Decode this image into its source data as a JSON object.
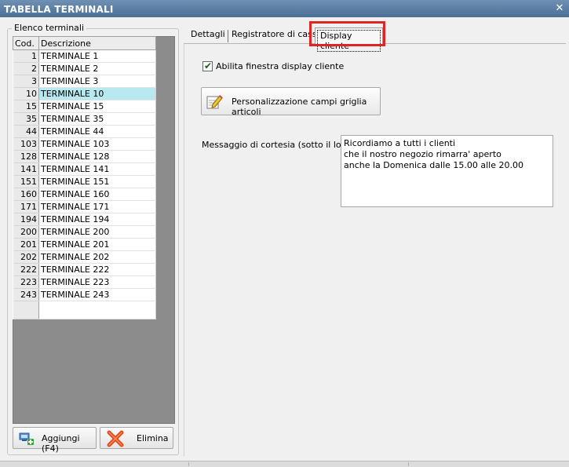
{
  "window": {
    "title": "TABELLA TERMINALI",
    "close_glyph": "✕"
  },
  "group": {
    "title": "Elenco terminali"
  },
  "grid": {
    "columns": [
      "Cod.",
      "Descrizione"
    ],
    "rows": [
      {
        "code": "1",
        "desc": "TERMINALE 1"
      },
      {
        "code": "2",
        "desc": "TERMINALE 2"
      },
      {
        "code": "3",
        "desc": "TERMINALE 3"
      },
      {
        "code": "10",
        "desc": "TERMINALE 10"
      },
      {
        "code": "15",
        "desc": "TERMINALE 15"
      },
      {
        "code": "35",
        "desc": "TERMINALE 35"
      },
      {
        "code": "44",
        "desc": "TERMINALE 44"
      },
      {
        "code": "103",
        "desc": "TERMINALE 103"
      },
      {
        "code": "128",
        "desc": "TERMINALE 128"
      },
      {
        "code": "141",
        "desc": "TERMINALE 141"
      },
      {
        "code": "151",
        "desc": "TERMINALE 151"
      },
      {
        "code": "160",
        "desc": "TERMINALE 160"
      },
      {
        "code": "171",
        "desc": "TERMINALE 171"
      },
      {
        "code": "194",
        "desc": "TERMINALE 194"
      },
      {
        "code": "200",
        "desc": "TERMINALE 200"
      },
      {
        "code": "201",
        "desc": "TERMINALE 201"
      },
      {
        "code": "202",
        "desc": "TERMINALE 202"
      },
      {
        "code": "222",
        "desc": "TERMINALE 222"
      },
      {
        "code": "223",
        "desc": "TERMINALE 223"
      },
      {
        "code": "243",
        "desc": "TERMINALE 243"
      }
    ],
    "selected_code": "10"
  },
  "buttons": {
    "add": "Aggiungi (F4)",
    "delete": "Elimina"
  },
  "tabs": [
    "Dettagli",
    "Registratore di cassa",
    "Display cliente"
  ],
  "active_tab": 2,
  "display": {
    "enable_label": "Abilita finestra display cliente",
    "enable_checked": true,
    "customize_label": "Personalizzazione campi griglia articoli",
    "message_label": "Messaggio di cortesia (sotto il logo) :",
    "message_lines": [
      "Ricordiamo a tutti i clienti",
      "che il nostro negozio rimarra' aperto",
      "anche la Domenica dalle 15.00 alle 20.00"
    ]
  },
  "colors": {
    "titlebar": "#5a7ea6",
    "selection": "#b8e8f0",
    "highlight": "#e02424"
  },
  "icons": {
    "close": "close-icon",
    "add": "add-terminal-icon",
    "delete": "delete-x-icon",
    "check": "check-icon",
    "customize": "pencil-note-icon"
  }
}
